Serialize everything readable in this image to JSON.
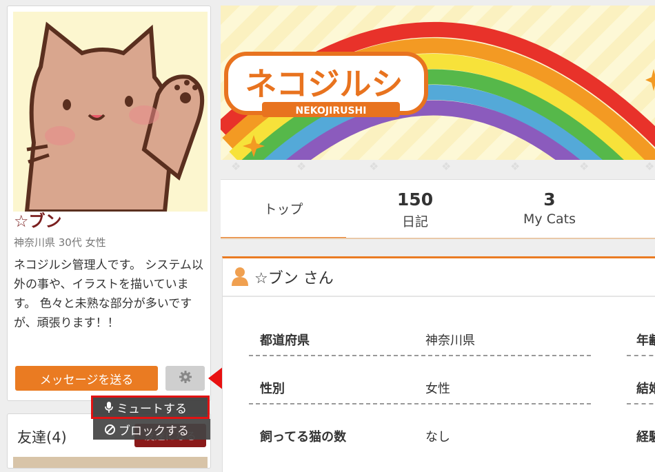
{
  "profile": {
    "name": "☆ブン",
    "meta": "神奈川県 30代 女性",
    "bio": "ネコジルシ管理人です。 システム以外の事や、イラストを描いています。 色々と未熟な部分が多いですが、頑張ります！！",
    "message_button": "メッセージを送る",
    "settings_icon": "gear-icon"
  },
  "dropdown": {
    "mute_label": "ミュートする",
    "mute_icon": "microphone-icon",
    "block_label": "ブロックする",
    "block_icon": "prohibited-icon"
  },
  "friends": {
    "title": "友達(4)",
    "button_label": "友達になる"
  },
  "banner": {
    "logo_text": "ネコジルシ",
    "logo_sub": "NEKOJIRUSHI"
  },
  "tabs": {
    "top_label": "トップ",
    "diary_count": "150",
    "diary_label": "日記",
    "cats_count": "3",
    "cats_label": "My Cats"
  },
  "detail": {
    "title": "☆ブン さん",
    "rows": [
      {
        "label": "都道府県",
        "value": "神奈川県",
        "label2": "年齢"
      },
      {
        "label": "性別",
        "value": "女性",
        "label2": "結婚"
      },
      {
        "label": "飼ってる猫の数",
        "value": "なし",
        "label2": "経験"
      }
    ]
  },
  "colors": {
    "accent": "#ea7b22",
    "name": "#7a1f1f",
    "highlight": "#e00000"
  }
}
